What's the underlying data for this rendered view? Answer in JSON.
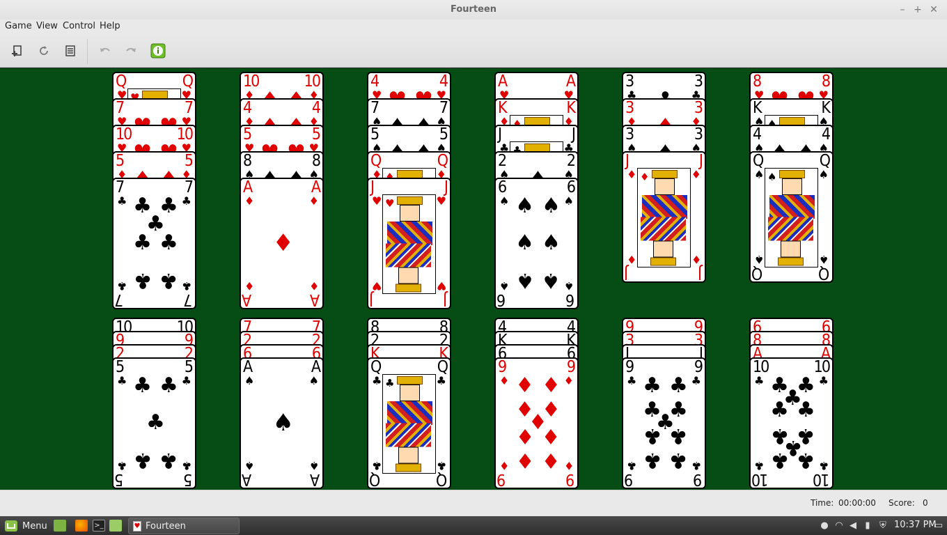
{
  "window": {
    "title": "Fourteen"
  },
  "window_controls": {
    "minimize": "–",
    "maximize": "+",
    "close": "✕"
  },
  "menu": [
    "Game",
    "View",
    "Control",
    "Help"
  ],
  "toolbar": {
    "icons": [
      "new-game-icon",
      "restart-icon",
      "statistics-icon",
      "undo-icon",
      "redo-icon",
      "hint-icon"
    ]
  },
  "colors": {
    "felt": "#054d14",
    "red_suit": "#e00000",
    "black_suit": "#000000"
  },
  "tableau": {
    "top_row": [
      [
        {
          "rank": "Q",
          "suit": "hearts"
        },
        {
          "rank": "7",
          "suit": "hearts"
        },
        {
          "rank": "10",
          "suit": "hearts"
        },
        {
          "rank": "5",
          "suit": "diamonds"
        },
        {
          "rank": "7",
          "suit": "clubs"
        }
      ],
      [
        {
          "rank": "10",
          "suit": "diamonds"
        },
        {
          "rank": "4",
          "suit": "diamonds"
        },
        {
          "rank": "5",
          "suit": "hearts"
        },
        {
          "rank": "8",
          "suit": "spades"
        },
        {
          "rank": "A",
          "suit": "diamonds"
        }
      ],
      [
        {
          "rank": "4",
          "suit": "hearts"
        },
        {
          "rank": "7",
          "suit": "spades"
        },
        {
          "rank": "5",
          "suit": "spades"
        },
        {
          "rank": "Q",
          "suit": "diamonds"
        },
        {
          "rank": "J",
          "suit": "hearts"
        }
      ],
      [
        {
          "rank": "A",
          "suit": "hearts"
        },
        {
          "rank": "K",
          "suit": "diamonds"
        },
        {
          "rank": "J",
          "suit": "clubs"
        },
        {
          "rank": "2",
          "suit": "spades"
        },
        {
          "rank": "6",
          "suit": "spades"
        }
      ],
      [
        {
          "rank": "3",
          "suit": "clubs"
        },
        {
          "rank": "3",
          "suit": "diamonds"
        },
        {
          "rank": "3",
          "suit": "spades"
        },
        {
          "rank": "J",
          "suit": "diamonds"
        }
      ],
      [
        {
          "rank": "8",
          "suit": "hearts"
        },
        {
          "rank": "K",
          "suit": "spades"
        },
        {
          "rank": "4",
          "suit": "spades"
        },
        {
          "rank": "Q",
          "suit": "spades"
        }
      ]
    ],
    "bottom_row": [
      [
        {
          "rank": "10",
          "suit": "spades"
        },
        {
          "rank": "9",
          "suit": "hearts"
        },
        {
          "rank": "2",
          "suit": "hearts"
        },
        {
          "rank": "5",
          "suit": "clubs"
        }
      ],
      [
        {
          "rank": "7",
          "suit": "hearts"
        },
        {
          "rank": "2",
          "suit": "hearts"
        },
        {
          "rank": "6",
          "suit": "hearts"
        },
        {
          "rank": "A",
          "suit": "spades"
        }
      ],
      [
        {
          "rank": "8",
          "suit": "spades"
        },
        {
          "rank": "2",
          "suit": "spades"
        },
        {
          "rank": "K",
          "suit": "hearts"
        },
        {
          "rank": "Q",
          "suit": "clubs"
        }
      ],
      [
        {
          "rank": "4",
          "suit": "clubs"
        },
        {
          "rank": "K",
          "suit": "clubs"
        },
        {
          "rank": "6",
          "suit": "clubs"
        },
        {
          "rank": "9",
          "suit": "diamonds"
        }
      ],
      [
        {
          "rank": "9",
          "suit": "hearts"
        },
        {
          "rank": "3",
          "suit": "hearts"
        },
        {
          "rank": "J",
          "suit": "spades"
        },
        {
          "rank": "9",
          "suit": "clubs"
        }
      ],
      [
        {
          "rank": "6",
          "suit": "diamonds"
        },
        {
          "rank": "8",
          "suit": "hearts"
        },
        {
          "rank": "A",
          "suit": "diamonds"
        },
        {
          "rank": "10",
          "suit": "clubs"
        }
      ]
    ]
  },
  "status": {
    "time_label": "Time:",
    "time_value": "00:00:00",
    "score_label": "Score:",
    "score_value": "0"
  },
  "taskbar": {
    "menu_label": "Menu",
    "launchers": [
      "show-desktop-icon",
      "firefox-icon",
      "terminal-icon",
      "files-icon"
    ],
    "active_task": "Fourteen",
    "tray_icons": [
      "user-icon",
      "wifi-icon",
      "volume-icon",
      "battery-icon",
      "shield-icon"
    ],
    "clock": "10:37 PM",
    "end_icon": "workspace-icon"
  }
}
